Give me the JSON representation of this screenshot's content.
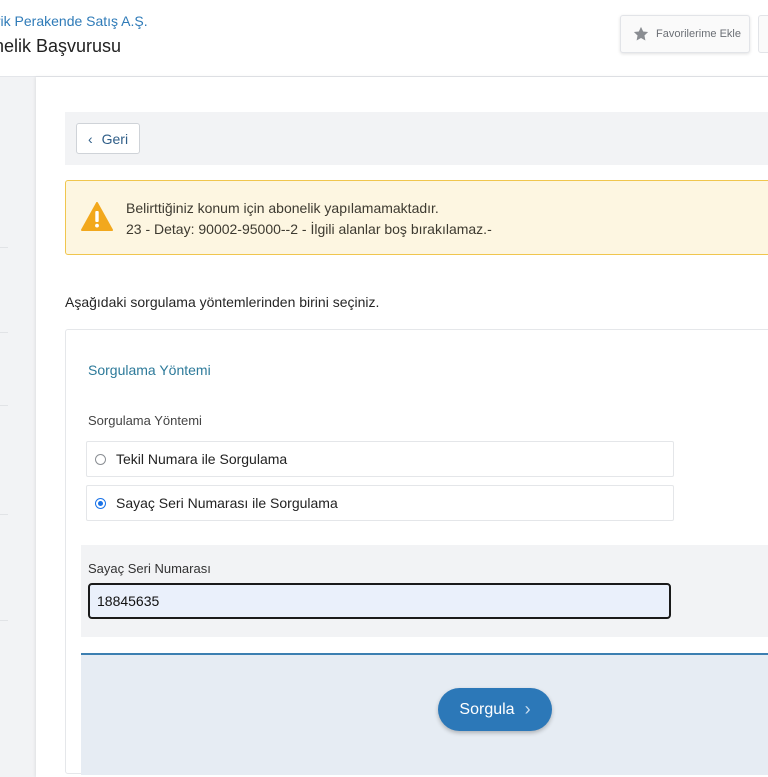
{
  "header": {
    "company": "trik Perakende Satış A.Ş.",
    "title": "nelik Başvurusu",
    "favorites_label": "Favorilerime Ekle",
    "favorites_icon": "star-icon"
  },
  "toolbar": {
    "back_label": "Geri",
    "back_icon": "chevron-left-icon"
  },
  "warning": {
    "icon": "warning-triangle-icon",
    "line1": "Belirttiğiniz konum için abonelik yapılamamaktadır.",
    "line2": "23 - Detay: 90002-95000--2 - İlgili alanlar boş bırakılamaz.-",
    "color": "#f0c64e"
  },
  "instruction": "Aşağıdaki sorgulama yöntemlerinden birini seçiniz.",
  "method_card": {
    "title": "Sorgulama Yöntemi",
    "field_label": "Sorgulama Yöntemi",
    "options": [
      {
        "label": "Tekil Numara ile Sorgulama",
        "selected": false
      },
      {
        "label": "Sayaç Seri Numarası ile Sorgulama",
        "selected": true
      }
    ]
  },
  "serial": {
    "label": "Sayaç Seri Numarası",
    "value": "18845635"
  },
  "actions": {
    "query_label": "Sorgula",
    "query_icon": "chevron-right-icon",
    "accent_color": "#2c78b8"
  }
}
